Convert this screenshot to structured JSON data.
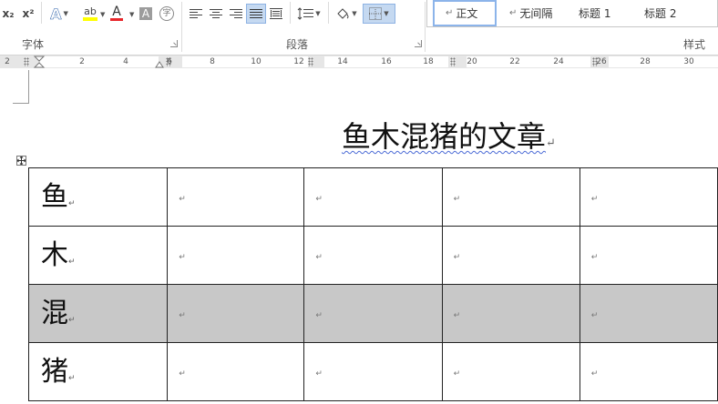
{
  "ribbon": {
    "font_group": {
      "label": "字体",
      "subscript": "x₂",
      "superscript": "x²",
      "text_effects": "A",
      "highlight": "ab",
      "font_color": "A",
      "char_shading": "A",
      "enclose_char": "字"
    },
    "paragraph_group": {
      "label": "段落"
    },
    "styles_group": {
      "label": "样式",
      "items": [
        "正文",
        "无间隔",
        "标题 1",
        "标题 2"
      ]
    }
  },
  "ruler": {
    "numbers": [
      "2",
      "2",
      "4",
      "6",
      "8",
      "10",
      "12",
      "14",
      "16",
      "18",
      "20",
      "22",
      "24",
      "26",
      "28",
      "30"
    ]
  },
  "document": {
    "title": "鱼木混猪的文章",
    "rows": [
      {
        "label": "鱼",
        "shaded": false
      },
      {
        "label": "木",
        "shaded": false
      },
      {
        "label": "混",
        "shaded": true
      },
      {
        "label": "猪",
        "shaded": false
      }
    ],
    "paragraph_mark": "↵"
  },
  "colors": {
    "highlight_bar": "#ffff00",
    "font_color_bar": "#e8262a",
    "selected_button": "#c5d9f1",
    "shaded_row": "#c8c8c8",
    "spell_underline": "#4a6ad6"
  }
}
